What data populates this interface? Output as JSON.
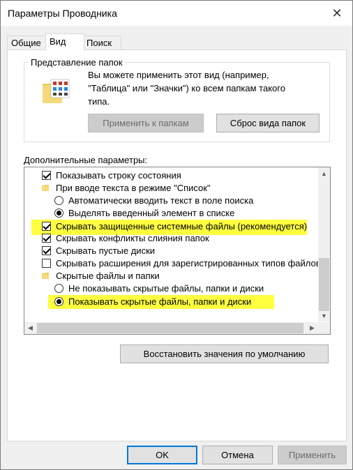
{
  "window": {
    "title": "Параметры Проводника"
  },
  "tabs": [
    {
      "label": "Общие",
      "active": false
    },
    {
      "label": "Вид",
      "active": true
    },
    {
      "label": "Поиск",
      "active": false
    }
  ],
  "folder_view": {
    "legend": "Представление папок",
    "description": "Вы можете применить этот вид (например, \"Таблица\" или \"Значки\") ко всем папкам такого типа.",
    "apply_button": "Применить к папкам",
    "reset_button": "Сброс вида папок"
  },
  "advanced": {
    "label": "Дополнительные параметры:",
    "items": [
      {
        "type": "checkbox",
        "checked": true,
        "label": "Показывать строку состояния"
      },
      {
        "type": "folder",
        "label": "При вводе текста в режиме \"Список\""
      },
      {
        "type": "radio",
        "checked": false,
        "label": "Автоматически вводить текст в поле поиска"
      },
      {
        "type": "radio",
        "checked": true,
        "label": "Выделять введенный элемент в списке"
      },
      {
        "type": "checkbox",
        "checked": true,
        "label": "Скрывать защищенные системные файлы (рекомендуется)",
        "highlighted": true
      },
      {
        "type": "checkbox",
        "checked": true,
        "label": "Скрывать конфликты слияния папок"
      },
      {
        "type": "checkbox",
        "checked": true,
        "label": "Скрывать пустые диски"
      },
      {
        "type": "checkbox",
        "checked": false,
        "label": "Скрывать расширения для зарегистрированных типов файлов"
      },
      {
        "type": "folder",
        "label": "Скрытые файлы и папки"
      },
      {
        "type": "radio",
        "checked": false,
        "label": "Не показывать скрытые файлы, папки и диски"
      },
      {
        "type": "radio",
        "checked": true,
        "label": "Показывать скрытые файлы, папки и диски",
        "highlighted": true
      }
    ],
    "restore_button": "Восстановить значения по умолчанию"
  },
  "footer": {
    "ok_button": "OK",
    "cancel_button": "Отмена",
    "apply_button": "Применить"
  },
  "colors": {
    "highlight": "#ffff40",
    "accent": "#0078d7"
  }
}
